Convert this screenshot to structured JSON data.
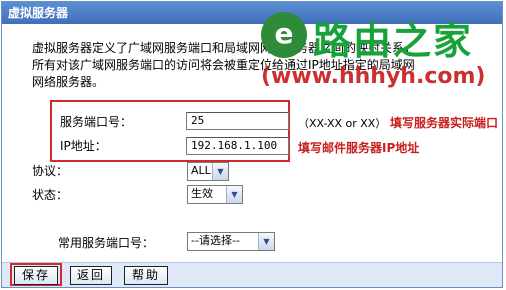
{
  "window": {
    "title": "虚拟服务器"
  },
  "description": {
    "line1": "虚拟服务器定义了广域网服务端口和局域网网络服务器之间的映射关系，",
    "line2": "所有对该广域网服务端口的访问将会被重定位给通过IP地址指定的局域网",
    "line3": "网络服务器。"
  },
  "form": {
    "service_port_label": "服务端口号：",
    "service_port_value": "25",
    "service_port_hint": "（XX-XX or XX）",
    "service_port_note": "填写服务器实际端口",
    "ip_label": "IP地址：",
    "ip_value": "192.168.1.100",
    "ip_note": "填写邮件服务器IP地址",
    "protocol_label": "协议：",
    "protocol_value": "ALL",
    "status_label": "状态：",
    "status_value": "生效",
    "common_port_label": "常用服务端口号：",
    "common_port_value": "--请选择--"
  },
  "buttons": {
    "save": "保存",
    "back": "返回",
    "help": "帮助"
  },
  "watermark": {
    "brand": "路由之家",
    "url": "(www.hhhyh.com)",
    "logo_letter": "e"
  },
  "colors": {
    "accent_red": "#d12a2a",
    "title_blue": "#3f6fb8",
    "brand_green": "#18a23a"
  }
}
